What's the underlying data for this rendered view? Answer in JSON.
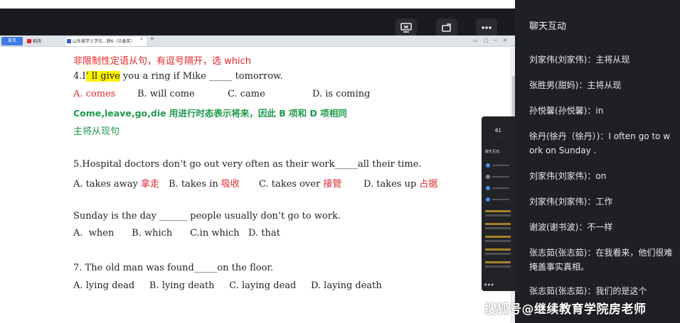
{
  "browser": {
    "tab_home": "首页",
    "tab_1": "稻壳",
    "tab_2": "山东德学士学位...题6（兰香奖）",
    "colors": {
      "tab_home": "#3d7be6",
      "fav_1": "#e0262a",
      "fav_2": "#2f63c9"
    }
  },
  "document": {
    "l1": "非限制性定语从句，有逗号隔开，选 which",
    "q4_pre": "4.I",
    "q4_hl": "’ ll give",
    "q4_post": " you a ring if Mike _____ tomorrow.",
    "q4_a": "A. comes",
    "q4_b": "B. will come",
    "q4_c": "C. came",
    "q4_d": "D. is coming",
    "note_1": "Come,leave,go,die 用进行时态表示将来，因此 B 项和 D 项相同",
    "note_2": "主将从现句",
    "q5": "5.Hospital doctors don’t go out very often as their work_____all their time.",
    "q5_a": "A. takes away ",
    "q5_a_cn": "拿走",
    "q5_b": "B. takes in ",
    "q5_b_cn": "吸收",
    "q5_c": "C. takes over ",
    "q5_c_cn": "接管",
    "q5_d": "D. takes up ",
    "q5_d_cn": "占据",
    "q6": "Sunday is the day ______ people usually don’t go to work.",
    "q6_opts": "A.  when      B. which      C.in which   D. that",
    "q7": "7. The old man was found_____on the floor.",
    "q7_opts": "A. lying dead     B. lying death     C. laying dead     D. laying death",
    "colors": {
      "red": "#e0262a",
      "green": "#1d9a4a",
      "highlight": "#fff200"
    }
  },
  "overlay": {
    "count": "61",
    "tab": "聊天互动"
  },
  "chat": {
    "title": "聊天互动",
    "messages": [
      "刘家伟(刘家伟)：主将从现",
      "张胜男(甜妈)：主将从现",
      "孙悦馨(孙悦馨)：in",
      "徐丹(徐丹（徐丹）)：I often go to work on Sunday .",
      "刘家伟(刘家伟)：on",
      "刘家伟(刘家伟)：工作",
      "谢波(谢书波)：不一样",
      "张志茹(张志茹)：在我看来，他们很难掩盖事实真相。",
      "张志茹(张志茹)：我们的是这个"
    ]
  },
  "watermark": "搜狐号@继续教育学院房老师",
  "icons": [
    "screen-share-icon",
    "rotate-screen-icon",
    "more-options-icon"
  ]
}
